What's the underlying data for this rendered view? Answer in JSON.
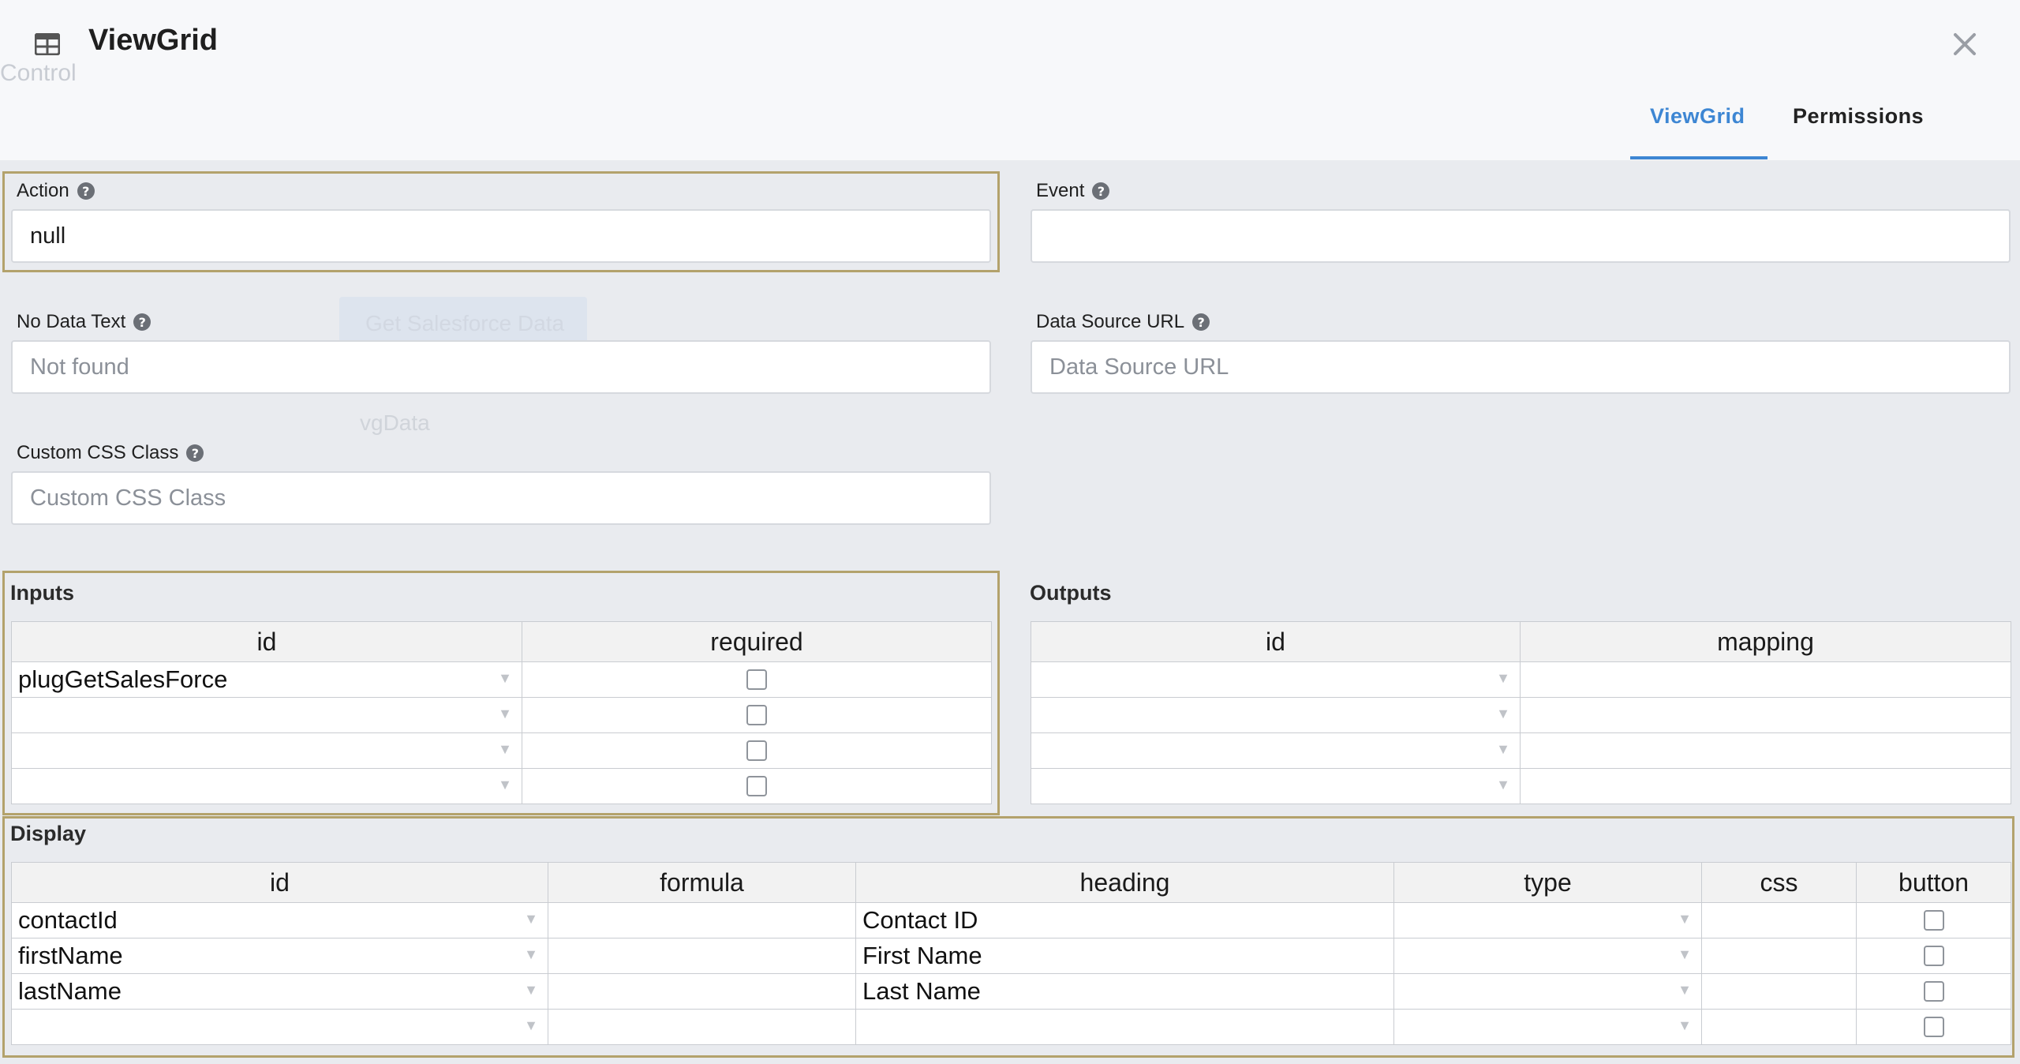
{
  "window": {
    "title": "ViewGrid",
    "icon": "table-icon",
    "close_icon": "close-icon"
  },
  "background_ghosts": {
    "control_text": "Control",
    "button_text": "Get Salesforce Data",
    "vgdata_text": "vgData"
  },
  "tabs": [
    {
      "label": "ViewGrid",
      "active": true
    },
    {
      "label": "Permissions",
      "active": false
    }
  ],
  "fields": {
    "action": {
      "label": "Action",
      "value": "null"
    },
    "event": {
      "label": "Event",
      "value": ""
    },
    "no_data_text": {
      "label": "No Data Text",
      "placeholder": "Not found"
    },
    "data_source_url": {
      "label": "Data Source URL",
      "placeholder": "Data Source URL"
    },
    "custom_css_class": {
      "label": "Custom CSS Class",
      "placeholder": "Custom CSS Class"
    }
  },
  "inputs": {
    "title": "Inputs",
    "columns": [
      "id",
      "required"
    ],
    "rows": [
      {
        "id": "plugGetSalesForce",
        "required": false
      },
      {
        "id": "",
        "required": false
      },
      {
        "id": "",
        "required": false
      },
      {
        "id": "",
        "required": false
      }
    ]
  },
  "outputs": {
    "title": "Outputs",
    "columns": [
      "id",
      "mapping"
    ],
    "rows": [
      {
        "id": "",
        "mapping": ""
      },
      {
        "id": "",
        "mapping": ""
      },
      {
        "id": "",
        "mapping": ""
      },
      {
        "id": "",
        "mapping": ""
      }
    ]
  },
  "display": {
    "title": "Display",
    "columns": [
      "id",
      "formula",
      "heading",
      "type",
      "css",
      "button"
    ],
    "rows": [
      {
        "id": "contactId",
        "formula": "",
        "heading": "Contact ID",
        "type": "",
        "css": "",
        "button": false
      },
      {
        "id": "firstName",
        "formula": "",
        "heading": "First Name",
        "type": "",
        "css": "",
        "button": false
      },
      {
        "id": "lastName",
        "formula": "",
        "heading": "Last Name",
        "type": "",
        "css": "",
        "button": false
      },
      {
        "id": "",
        "formula": "",
        "heading": "",
        "type": "",
        "css": "",
        "button": false
      }
    ]
  },
  "colors": {
    "accent": "#3d86d3",
    "highlight_border": "#b3a26c"
  }
}
